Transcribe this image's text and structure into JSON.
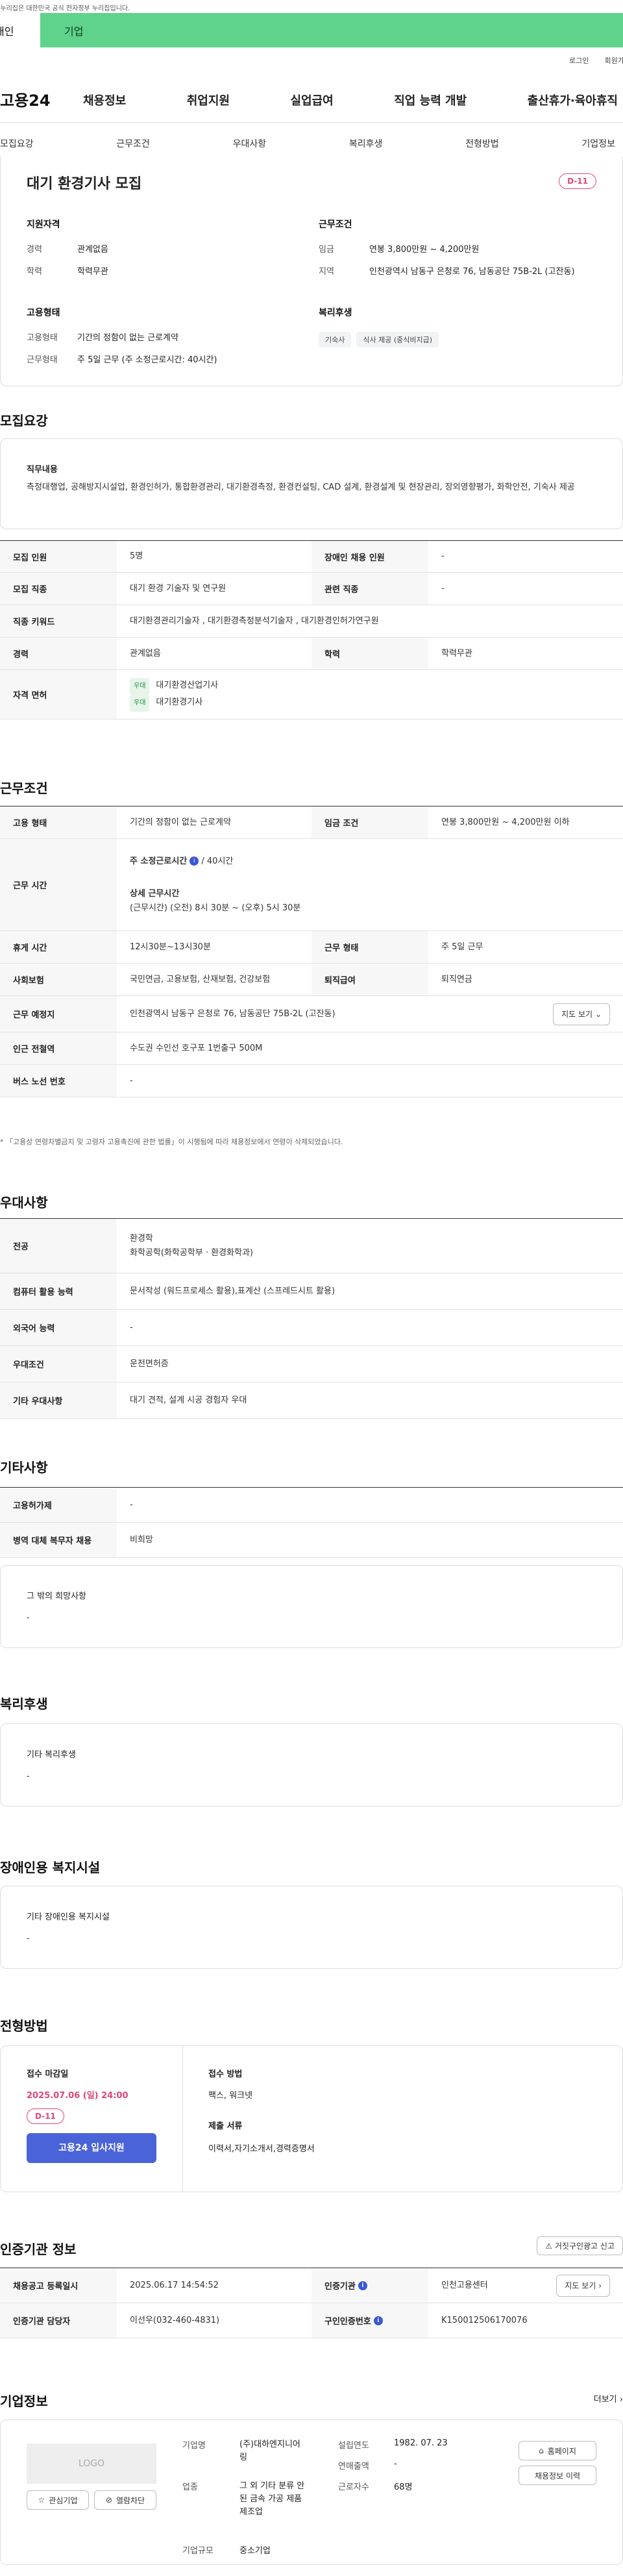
{
  "gov_banner": "이 누리집은 대한민국 공식 전자정부 누리집입니다.",
  "top_tabs": [
    "개인",
    "기업"
  ],
  "util_links": [
    "로그인",
    "회원가입"
  ],
  "brand": "고용24",
  "gnb": [
    "채용정보",
    "취업지원",
    "실업급여",
    "직업 능력 개발",
    "출산휴가·육아휴직"
  ],
  "subnav": [
    "모집요강",
    "근무조건",
    "우대사항",
    "복리후생",
    "전형방법",
    "기업정보"
  ],
  "summary": {
    "title": "대기 환경기사 모집",
    "dday": "D-11",
    "qual_h": "지원자격",
    "qual": [
      {
        "k": "경력",
        "v": "관계없음"
      },
      {
        "k": "학력",
        "v": "학력무관"
      }
    ],
    "cond_h": "근무조건",
    "cond": [
      {
        "k": "임금",
        "v": "연봉 3,800만원 ~ 4,200만원"
      },
      {
        "k": "지역",
        "v": "인천광역시 남동구 은청로 76, 남동공단 75B-2L (고잔동)"
      }
    ],
    "emp_h": "고용형태",
    "emp": [
      {
        "k": "고용형태",
        "v": "기간의 정함이 없는 근로계약"
      },
      {
        "k": "근무형태",
        "v": "주 5일 근무 (주 소정근로시간: 40시간)"
      }
    ],
    "wel_h": "복리후생",
    "wel_tags": [
      "기숙사",
      "식사 제공 (중식비지급)"
    ]
  },
  "recruit": {
    "heading": "모집요강",
    "duty_label": "직무내용",
    "duty": "측정대행업, 공해방지시설업, 환경인허가, 통합환경관리, 대기환경측정, 환경컨설팅, CAD 설계, 환경설계 및 현장관리, 장외영향평가, 화학안전, 기숙사 제공",
    "rows": {
      "people_k": "모집 인원",
      "people_v": "5명",
      "disab_k": "장애인 채용 인원",
      "disab_v": "-",
      "job_k": "모집 직종",
      "job_v": "대기 환경 기술자 및 연구원",
      "rel_k": "관련 직종",
      "rel_v": "-",
      "code_k": "직종 키워드",
      "code_v": "대기환경관리기술자 , 대기환경측정분석기술자 , 대기환경인허가연구원",
      "exp_k": "경력",
      "exp_v": "관계없음",
      "edu_k": "학력",
      "edu_v": "학력무관",
      "lic_k": "자격 면허",
      "lic_badge": "우대",
      "lic": [
        "대기환경산업기사",
        "대기환경기사"
      ]
    }
  },
  "work": {
    "heading": "근무조건",
    "type_k": "고용 형태",
    "type_v": "기간의 정함이 없는 근로계약",
    "pay_k": "임금 조건",
    "pay_v": "연봉 3,800만원 ~ 4,200만원 이하",
    "time_k": "근무 시간",
    "time_l1": "주 소정근로시간",
    "time_l1b": "/ 40시간",
    "time_l2": "상세 근무시간",
    "time_l3": "(근무시간) (오전) 8시 30분 ~ (오후) 5시 30분",
    "rest_k": "휴게 시간",
    "rest_v": "12시30분~13시30분",
    "shift_k": "근무 형태",
    "shift_v": "주 5일 근무",
    "ins_k": "사회보험",
    "ins_v": "국민연금, 고용보험, 산재보험, 건강보험",
    "ret_k": "퇴직급여",
    "ret_v": "퇴직연금",
    "place_k": "근무 예정지",
    "place_v": "인천광역시 남동구 은청로 76, 남동공단 75B-2L (고잔동)",
    "map_btn": "지도 보기",
    "sub_k": "인근 전철역",
    "sub_v": "수도권 수인선 호구포 1번출구 500M",
    "bus_k": "버스 노선 번호",
    "bus_v": "-",
    "note": "* 「고용상 연령차별금지 및 고령자 고용촉진에 관한 법률」이 시행됨에 따라 채용정보에서 연령이 삭제되었습니다."
  },
  "pref": {
    "heading": "우대사항",
    "major_k": "전공",
    "major_v1": "환경학",
    "major_v2": "화학공학(화학공학부 · 환경화학과)",
    "pc_k": "컴퓨터 활용 능력",
    "pc_v": "문서작성 (워드프로세스 활용),표계산 (스프레드시트 활용)",
    "lang_k": "외국어 능력",
    "lang_v": "-",
    "cond_k": "우대조건",
    "cond_v": "운전면허증",
    "etc_k": "기타 우대사항",
    "etc_v": "대기 견적, 설계 시공 경험자 우대"
  },
  "other": {
    "heading": "기타사항",
    "emp_k": "고용허가제",
    "emp_v": "-",
    "mil_k": "병역 대체 복무자 채용",
    "mil_v": "비희망",
    "hope_label": "그 밖의 희망사항",
    "hope_v": "-"
  },
  "welfare": {
    "heading": "복리후생",
    "label": "기타 복리후생",
    "v": "-"
  },
  "disab_fac": {
    "heading": "장애인용 복지시설",
    "label": "기타 장애인용 복지시설",
    "v": "-"
  },
  "process": {
    "heading": "전형방법",
    "deadline_label": "접수 마감일",
    "deadline": "2025.07.06 (일) 24:00",
    "dday": "D-11",
    "apply_btn": "고용24 입사지원",
    "method_label": "접수 방법",
    "method": "팩스, 워크넷",
    "docs_label": "제출 서류",
    "docs": "이력서,자기소개서,경력증명서"
  },
  "cert": {
    "heading": "인증기관 정보",
    "report_btn": "거짓구인광고 신고",
    "reg_k": "채용공고 등록일시",
    "reg_v": "2025.06.17 14:54:52",
    "org_k": "인증기관",
    "org_v": "인천고용센터",
    "map_btn": "지도 보기",
    "mgr_k": "인증기관 담당자",
    "mgr_v": "이선우(032-460-4831)",
    "id_k": "구인인증번호",
    "id_v": "K150012506170076"
  },
  "company": {
    "heading": "기업정보",
    "more": "더보기",
    "logo": "LOGO",
    "fav_btn": "관심기업",
    "block_btn": "열람차단",
    "name_k": "기업명",
    "name_v": "(주)대하엔지니어링",
    "biz_k": "업종",
    "biz_v": "그 외 기타 분류 안된 금속 가공 제품 제조업",
    "size_k": "기업규모",
    "size_v": "중소기업",
    "year_k": "설립연도",
    "year_v": "1982. 07. 23",
    "sales_k": "연매출액",
    "sales_v": "-",
    "staff_k": "근로자수",
    "staff_v": "68명",
    "home_btn": "홈페이지",
    "list_btn": "채용정보 이력"
  }
}
